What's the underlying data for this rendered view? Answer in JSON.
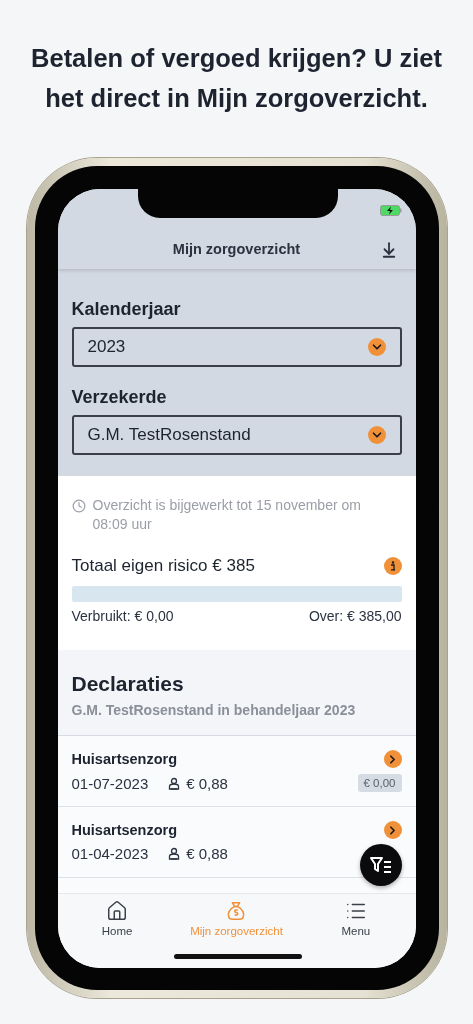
{
  "headline": "Betalen of vergoed krijgen? U ziet het direct in Mijn zorgoverzicht.",
  "header": {
    "title": "Mijn zorgoverzicht"
  },
  "filters": [
    {
      "label": "Kalenderjaar",
      "value": "2023"
    },
    {
      "label": "Verzekerde",
      "value": "G.M. TestRosenstand"
    }
  ],
  "update_note": "Overzicht is bijgewerkt tot 15 november om 08:09 uur",
  "deductible": {
    "title": "Totaal eigen risico € 385",
    "level": 0,
    "used": "Verbruikt: € 0,00",
    "remaining": "Over: € 385,00"
  },
  "claims": {
    "title": "Declaraties",
    "subtitle": "G.M. TestRosenstand in behandeljaar 2023",
    "rows": [
      {
        "name": "Huisartsenzorg",
        "date": "01-07-2023",
        "amount": "€ 0,88",
        "badge": "€ 0,00"
      },
      {
        "name": "Huisartsenzorg",
        "date": "01-04-2023",
        "amount": "€ 0,88"
      }
    ]
  },
  "tabs": [
    {
      "label": "Home",
      "kind": "home",
      "selected": false
    },
    {
      "label": "Mijn zorgoverzicht",
      "kind": "bag",
      "selected": true
    },
    {
      "label": "Menu",
      "kind": "menu",
      "selected": false
    }
  ]
}
